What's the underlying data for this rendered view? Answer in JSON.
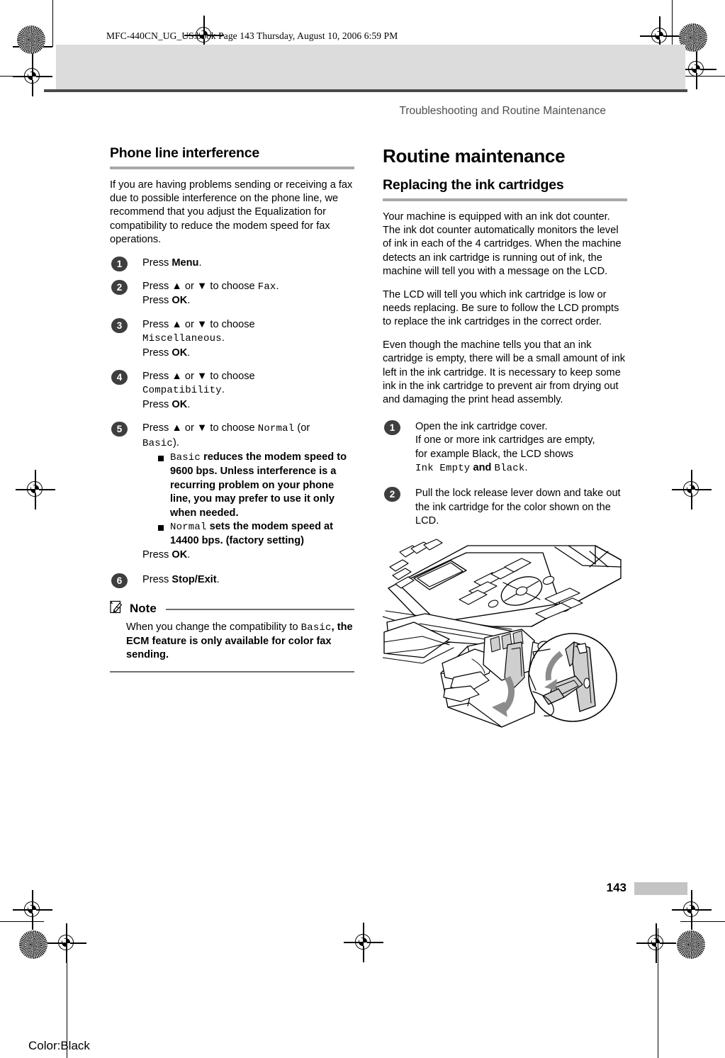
{
  "book_header": "MFC-440CN_UG_US.book  Page 143  Thursday, August 10, 2006  6:59 PM",
  "running_header": "Troubleshooting and Routine Maintenance",
  "footer": {
    "page_number": "143",
    "color_label": "Color:Black"
  },
  "left_column": {
    "section_heading": "Phone line interference",
    "intro": "If you are having problems sending or receiving a fax due to possible interference on the phone line, we recommend that you adjust the Equalization for compatibility to reduce the modem speed for fax operations.",
    "steps": [
      {
        "number": "1",
        "line1_pre": "Press ",
        "line1_bold": "Menu",
        "line1_post": "."
      },
      {
        "number": "2",
        "line1_pre": "Press ▲ or ▼ to choose ",
        "line1_mono": "Fax",
        "line1_post": ".",
        "line2_pre": "Press ",
        "line2_bold": "OK",
        "line2_post": "."
      },
      {
        "number": "3",
        "line1_pre": "Press ▲ or ▼ to choose",
        "line2_mono": "Miscellaneous",
        "line2_post": ".",
        "line3_pre": "Press ",
        "line3_bold": "OK",
        "line3_post": "."
      },
      {
        "number": "4",
        "line1_pre": "Press ▲ or ▼ to choose",
        "line2_mono": "Compatibility",
        "line2_post": ".",
        "line3_pre": "Press ",
        "line3_bold": "OK",
        "line3_post": "."
      },
      {
        "number": "5",
        "line1_pre": "Press ▲ or ▼ to choose ",
        "line1_mono": "Normal",
        "line1_post": " (or",
        "line2_mono": "Basic",
        "line2_post": ").",
        "bullets": [
          {
            "mono": "Basic",
            "text": " reduces the modem speed to 9600 bps. Unless interference is a recurring problem on your phone line, you may prefer to use it only when needed."
          },
          {
            "mono": "Normal",
            "text": " sets the modem speed at 14400 bps. (factory setting)"
          }
        ],
        "tail_pre": "Press ",
        "tail_bold": "OK",
        "tail_post": "."
      },
      {
        "number": "6",
        "line1_pre": "Press ",
        "line1_bold": "Stop/Exit",
        "line1_post": "."
      }
    ],
    "note": {
      "title": "Note",
      "icon": "note-pencil-icon",
      "text_pre": "When you change the compatibility to ",
      "text_mono": "Basic",
      "text_post": ", the ECM feature is only available for color fax sending."
    }
  },
  "right_column": {
    "main_heading": "Routine maintenance",
    "section_heading": "Replacing the ink cartridges",
    "paragraphs": [
      "Your machine is equipped with an ink dot counter. The ink dot counter automatically monitors the level of ink in each of the 4 cartridges. When the machine detects an ink cartridge is running out of ink, the machine will tell you with a message on the LCD.",
      "The LCD will tell you which ink cartridge is low or needs replacing. Be sure to follow the LCD prompts to replace the ink cartridges in the correct order.",
      "Even though the machine tells you that an ink cartridge is empty, there will be a small amount of ink left in the ink cartridge. It is necessary to keep some ink in the ink cartridge to prevent air from drying out and damaging the print head assembly."
    ],
    "steps": [
      {
        "number": "1",
        "line1": "Open the ink cartridge cover.",
        "line2": "If one or more ink cartridges are empty,",
        "line3": "for example Black, the LCD shows",
        "line4_mono1": "Ink Empty",
        "line4_mid": " and ",
        "line4_mono2": "Black",
        "line4_post": "."
      },
      {
        "number": "2",
        "line1": "Pull the lock release lever down and take out the ink cartridge for the color shown on the LCD."
      }
    ],
    "illustration_name": "printer-ink-cartridge-illustration"
  }
}
